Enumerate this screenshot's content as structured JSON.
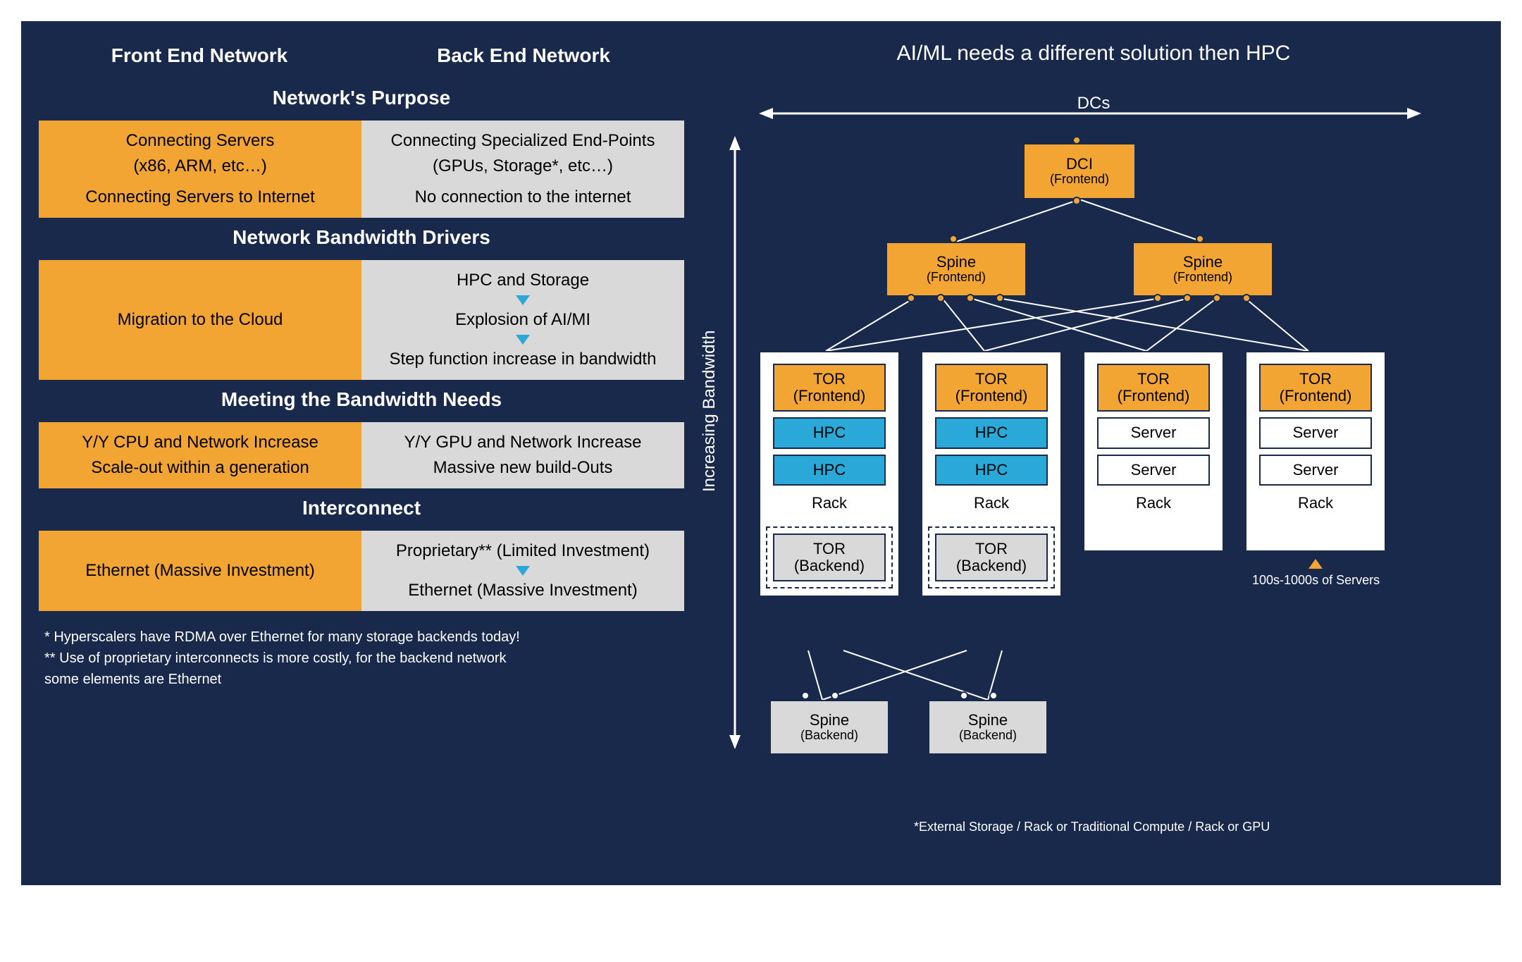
{
  "left": {
    "col_headers": [
      "Front End Network",
      "Back End Network"
    ],
    "sections": [
      {
        "title": "Network's Purpose",
        "front": [
          "Connecting Servers",
          "(x86, ARM, etc…)",
          "Connecting Servers to Internet"
        ],
        "back": [
          "Connecting Specialized End-Points",
          "(GPUs, Storage*, etc…)",
          "No connection to the internet"
        ]
      },
      {
        "title": "Network Bandwidth Drivers",
        "front": [
          "Migration to the Cloud"
        ],
        "back_flow": [
          "HPC and Storage",
          "Explosion of AI/MI",
          "Step function increase in bandwidth"
        ]
      },
      {
        "title": "Meeting the Bandwidth Needs",
        "front": [
          "Y/Y CPU and Network Increase",
          "Scale-out within a generation"
        ],
        "back": [
          "Y/Y GPU and Network Increase",
          "Massive new build-Outs"
        ]
      },
      {
        "title": "Interconnect",
        "front": [
          "Ethernet (Massive Investment)"
        ],
        "back_flow": [
          "Proprietary** (Limited Investment)",
          "Ethernet (Massive Investment)"
        ]
      }
    ],
    "footnotes": [
      "* Hyperscalers have RDMA over Ethernet for many storage backends today!",
      "** Use of proprietary interconnects is more costly, for the backend network",
      "    some elements are Ethernet"
    ]
  },
  "right": {
    "headline": "AI/ML needs a different solution then HPC",
    "axis_x": "DCs",
    "axis_y": "Increasing Bandwidth",
    "dci": {
      "t": "DCI",
      "s": "(Frontend)"
    },
    "spine_fe": {
      "t": "Spine",
      "s": "(Frontend)"
    },
    "tor_fe": {
      "t": "TOR",
      "s": "(Frontend)"
    },
    "hpc": "HPC",
    "server": "Server",
    "rack": "Rack",
    "tor_be": {
      "t": "TOR",
      "s": "(Backend)"
    },
    "spine_be": {
      "t": "Spine",
      "s": "(Backend)"
    },
    "callout_label": "100s-1000s of Servers",
    "footnote": "*External Storage / Rack or Traditional Compute / Rack or GPU"
  }
}
